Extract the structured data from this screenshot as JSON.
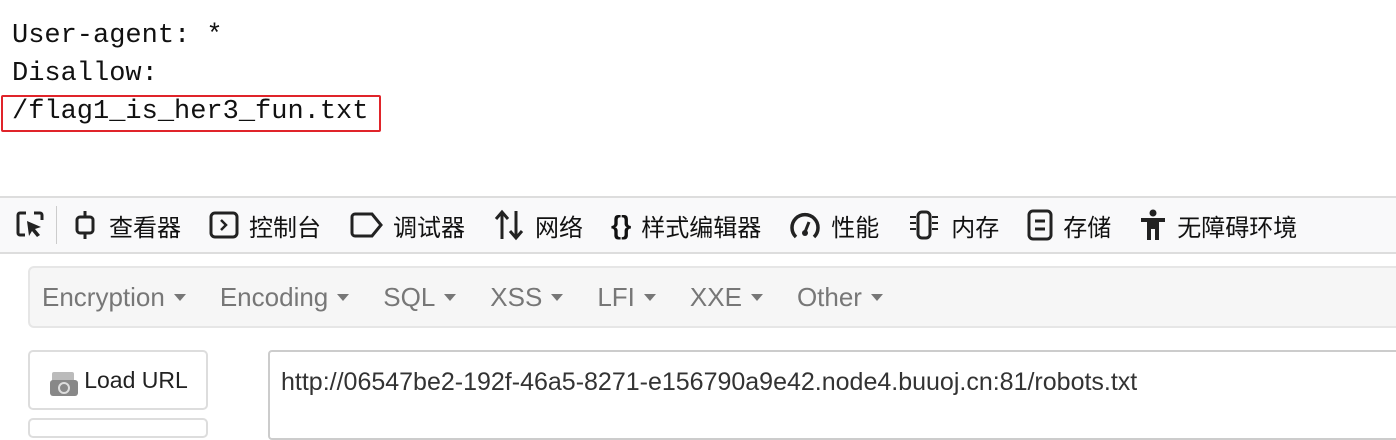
{
  "page": {
    "lines": [
      "User-agent: *",
      "Disallow:",
      "/flag1_is_her3_fun.txt"
    ],
    "highlight_color": "#e0242a"
  },
  "devtools": {
    "tabs": [
      {
        "label": "查看器",
        "icon": "inspector-icon"
      },
      {
        "label": "控制台",
        "icon": "console-icon"
      },
      {
        "label": "调试器",
        "icon": "debugger-icon"
      },
      {
        "label": "网络",
        "icon": "network-icon"
      },
      {
        "label": "样式编辑器",
        "icon": "style-editor-icon"
      },
      {
        "label": "性能",
        "icon": "performance-icon"
      },
      {
        "label": "内存",
        "icon": "memory-icon"
      },
      {
        "label": "存储",
        "icon": "storage-icon"
      },
      {
        "label": "无障碍环境",
        "icon": "accessibility-icon"
      }
    ]
  },
  "hackbar": {
    "menus": [
      "Encryption",
      "Encoding",
      "SQL",
      "XSS",
      "LFI",
      "XXE",
      "Other"
    ],
    "load_url_label": "Load URL",
    "url_value": "http://06547be2-192f-46a5-8271-e156790a9e42.node4.buuoj.cn:81/robots.txt"
  }
}
